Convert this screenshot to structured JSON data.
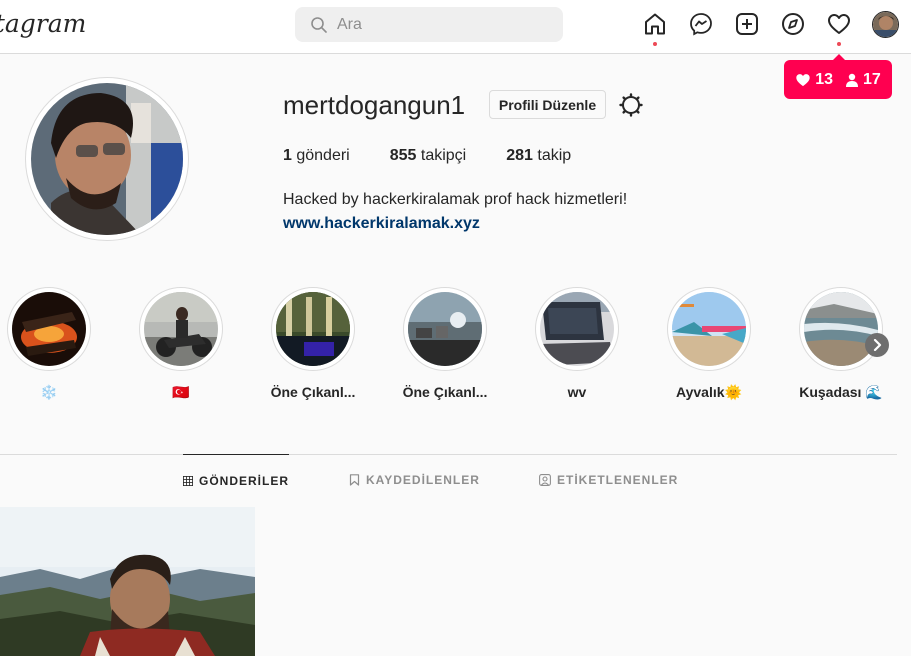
{
  "header": {
    "logo_text": "Instagram",
    "search_placeholder": "Ara",
    "icons": [
      "home-icon",
      "messenger-icon",
      "new-post-icon",
      "explore-icon",
      "heart-icon",
      "profile-avatar"
    ]
  },
  "notifications": {
    "likes": "13",
    "follows": "17",
    "color": "#ff0050"
  },
  "profile": {
    "username": "mertdogangun1",
    "edit_label": "Profili Düzenle",
    "stats": {
      "posts_count": "1",
      "posts_label": " gönderi",
      "followers_count": "855",
      "followers_label": " takipçi",
      "following_count": "281",
      "following_label": " takip"
    },
    "bio": "Hacked by hackerkiralamak prof hack hizmetleri!",
    "website": "www.hackerkiralamak.xyz"
  },
  "highlights": [
    {
      "label": "❄️"
    },
    {
      "label": "🇹🇷"
    },
    {
      "label": "Öne Çıkanl..."
    },
    {
      "label": "Öne Çıkanl..."
    },
    {
      "label": "wv"
    },
    {
      "label": "Ayvalık🌞"
    },
    {
      "label": "Kuşadası 🌊"
    }
  ],
  "tabs": [
    {
      "label": "GÖNDERİLER",
      "active": true
    },
    {
      "label": "KAYDEDİLENLER",
      "active": false
    },
    {
      "label": "ETİKETLENENLER",
      "active": false
    }
  ]
}
